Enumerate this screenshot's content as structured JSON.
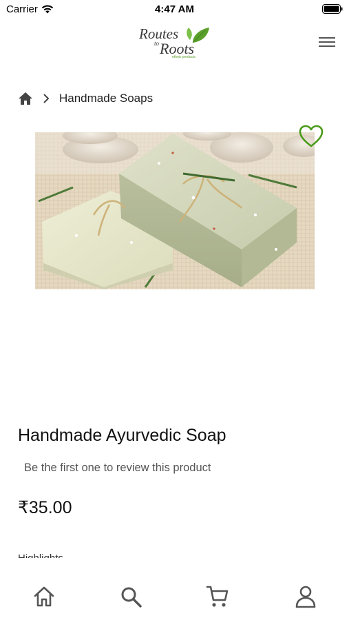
{
  "status_bar": {
    "carrier": "Carrier",
    "time": "4:47 AM"
  },
  "header": {
    "logo_text_top": "Routes",
    "logo_text_to": "to",
    "logo_text_bottom": "Roots",
    "logo_tagline": "ethnic products",
    "logo_color": "#3a3a3a",
    "leaf_color": "#5aa02c"
  },
  "breadcrumb": {
    "current": "Handmade Soaps"
  },
  "product": {
    "name": "Handmade Ayurvedic Soap",
    "review_prompt": "Be the first one to review this product",
    "price": "₹35.00",
    "highlights_label": "Highlights",
    "wishlist_color": "#4a9a1a"
  },
  "bottom_nav": {
    "items": [
      "home",
      "search",
      "cart",
      "account"
    ],
    "icon_color": "#555555"
  }
}
